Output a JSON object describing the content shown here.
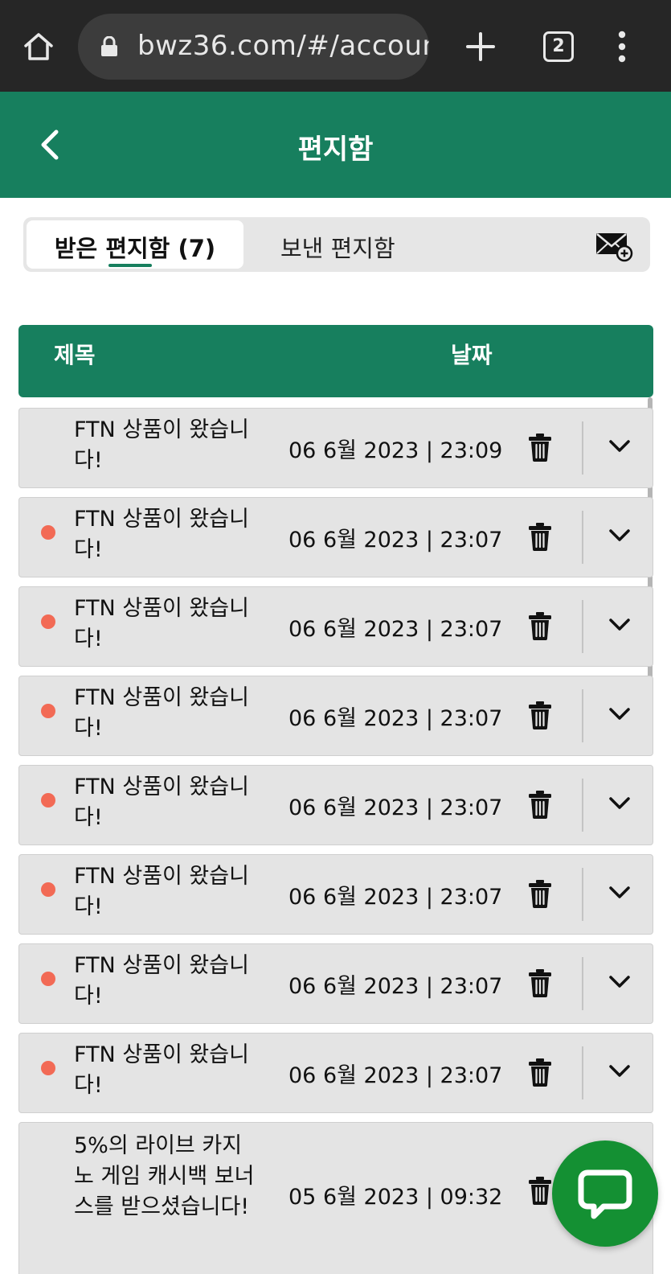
{
  "browser": {
    "url": "bwz36.com/#/accoun",
    "tab_count": "2",
    "icons": [
      "home-icon",
      "lock-icon",
      "plus-icon",
      "tabs-icon",
      "more-vert-icon"
    ]
  },
  "header": {
    "title": "편지함",
    "back_icon": "chevron-left-icon"
  },
  "tabs": {
    "inbox_label": "받은 편지함 (7)",
    "sent_label": "보낸 편지함",
    "compose_icon": "mail-add-icon"
  },
  "table": {
    "col_subject": "제목",
    "col_date": "날짜"
  },
  "messages": [
    {
      "unread": false,
      "subject": "FTN 상품이 왔습니다!",
      "date": "06 6월 2023 | 23:09"
    },
    {
      "unread": true,
      "subject": "FTN 상품이 왔습니다!",
      "date": "06 6월 2023 | 23:07"
    },
    {
      "unread": true,
      "subject": "FTN 상품이 왔습니다!",
      "date": "06 6월 2023 | 23:07"
    },
    {
      "unread": true,
      "subject": "FTN 상품이 왔습니다!",
      "date": "06 6월 2023 | 23:07"
    },
    {
      "unread": true,
      "subject": "FTN 상품이 왔습니다!",
      "date": "06 6월 2023 | 23:07"
    },
    {
      "unread": true,
      "subject": "FTN 상품이 왔습니다!",
      "date": "06 6월 2023 | 23:07"
    },
    {
      "unread": true,
      "subject": "FTN 상품이 왔습니다!",
      "date": "06 6월 2023 | 23:07"
    },
    {
      "unread": true,
      "subject": "FTN 상품이 왔습니다!",
      "date": "06 6월 2023 | 23:07"
    },
    {
      "unread": false,
      "subject": "5%의 라이브 카지노 게임 캐시백 보너스를 받으셨습니다!",
      "date": "05 6월 2023 | 09:32"
    }
  ],
  "colors": {
    "brand_green": "#177f5e",
    "unread_dot": "#f26a55",
    "chat_button": "#149033"
  },
  "fab_icon": "chat-icon"
}
